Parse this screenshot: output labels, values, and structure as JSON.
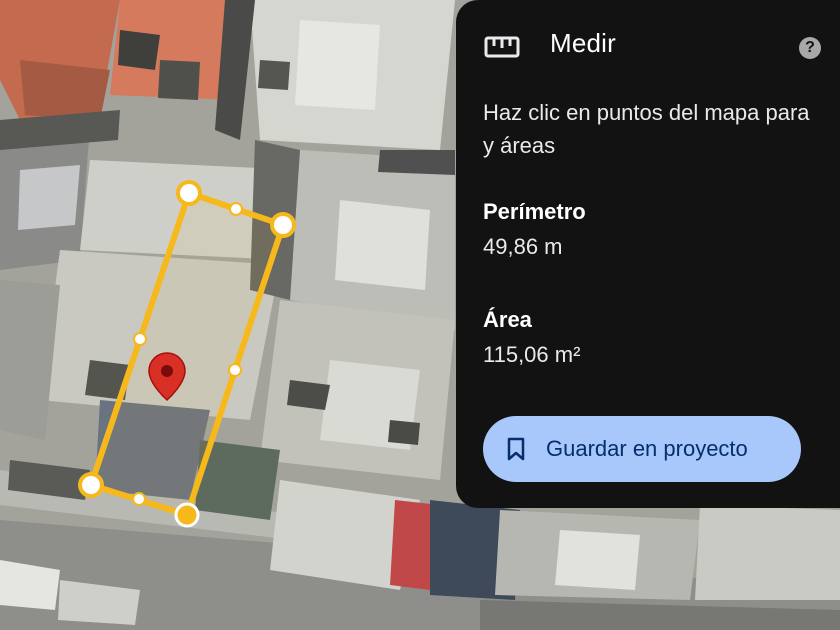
{
  "panel": {
    "title": "Medir",
    "title_icon": "ruler-icon",
    "help_icon": "help-icon",
    "help_glyph": "?",
    "instructions_line1": "Haz clic en puntos del mapa para",
    "instructions_line2": "y áreas",
    "perimeter_label": "Perímetro",
    "perimeter_value": "49,86 m",
    "area_label": "Área",
    "area_value": "115,06 m²",
    "save_button_label": "Guardar en proyecto",
    "save_button_icon": "bookmark-icon"
  },
  "map": {
    "polygon_color": "#f6b81a",
    "pin_color": "#d93025",
    "pin_icon": "location-pin-icon",
    "vertex_count": 4,
    "selected_vertex": 3
  },
  "colors": {
    "panel_bg": "#121212",
    "button_bg": "#a8c7fa",
    "button_text": "#062e6f"
  }
}
